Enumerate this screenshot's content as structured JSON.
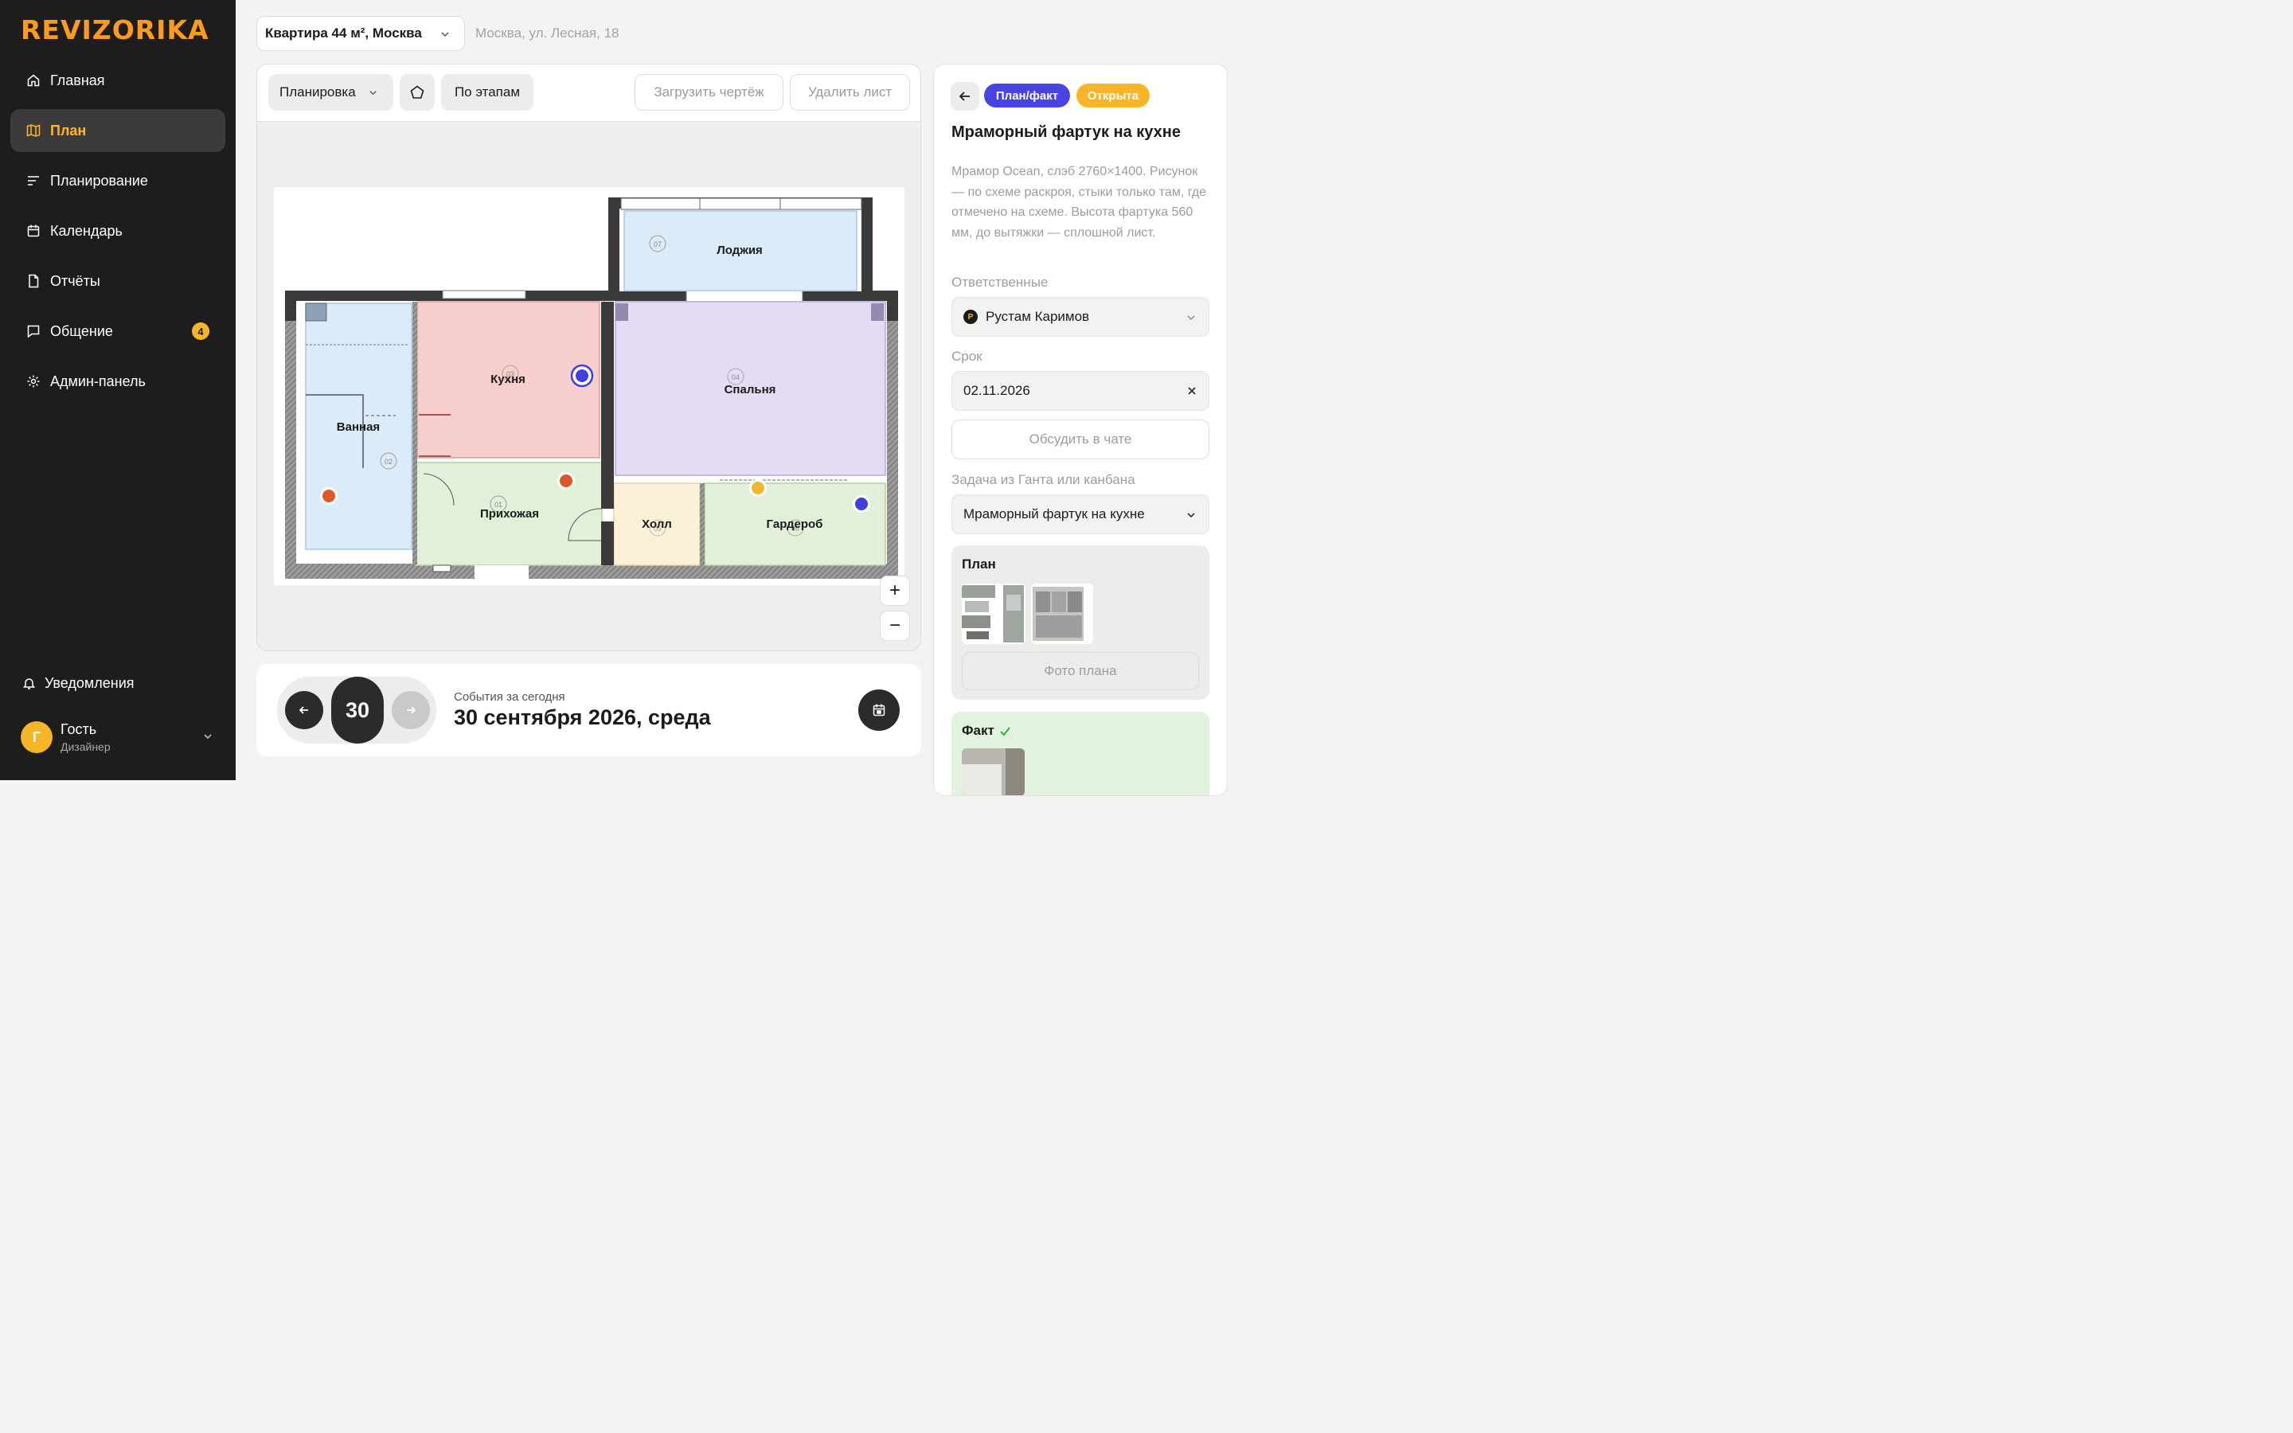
{
  "app": {
    "logo": "REVIZORIKA",
    "accent_color": "#ff9b1a"
  },
  "sidebar": {
    "items": [
      {
        "label": "Главная",
        "icon": "home-icon"
      },
      {
        "label": "План",
        "icon": "map-icon",
        "active": true
      },
      {
        "label": "Планирование",
        "icon": "list-icon"
      },
      {
        "label": "Календарь",
        "icon": "calendar-icon"
      },
      {
        "label": "Отчёты",
        "icon": "document-icon"
      },
      {
        "label": "Общение",
        "icon": "chat-icon",
        "badge": "4"
      },
      {
        "label": "Админ-панель",
        "icon": "gear-icon"
      }
    ],
    "notifications_label": "Уведомления",
    "user": {
      "initial": "Г",
      "name": "Гость",
      "role": "Дизайнер"
    }
  },
  "header": {
    "project": "Квартира 44 м², Москва",
    "address": "Москва, ул. Лесная, 18"
  },
  "plan": {
    "toolbar": {
      "layer_select": "Планировка",
      "stages_button": "По этапам",
      "upload_button": "Загрузить чертёж",
      "delete_button": "Удалить лист"
    },
    "rooms": [
      {
        "name": "Лоджия",
        "number": "07",
        "color": "#dcebf8"
      },
      {
        "name": "Кухня",
        "number": "03",
        "color": "#f6cfcd"
      },
      {
        "name": "Спальня",
        "number": "04",
        "color": "#e3dcf3"
      },
      {
        "name": "Ванная",
        "number": "02",
        "color": "#dcebf8"
      },
      {
        "name": "Прихожая",
        "number": "01",
        "color": "#e3f0d9"
      },
      {
        "name": "Холл",
        "number": "05",
        "color": "#fbf0d8"
      },
      {
        "name": "Гардероб",
        "number": "06",
        "color": "#e3f0d9"
      }
    ],
    "markers": [
      {
        "color": "#4040e0",
        "selected": true
      },
      {
        "color": "#e0552a"
      },
      {
        "color": "#e0552a"
      },
      {
        "color": "#f2b62d"
      },
      {
        "color": "#4040e0"
      }
    ],
    "zoom_in": "+",
    "zoom_out": "−"
  },
  "events": {
    "day": "30",
    "subtitle": "События за сегодня",
    "date": "30 сентября 2026, среда"
  },
  "task": {
    "tag_type": "План/факт",
    "tag_status": "Открыта",
    "title": "Мраморный фартук на кухне",
    "description": "Мрамор Ocean, слэб 2760×1400. Рисунок — по схеме раскроя, стыки только там, где отмечено на схеме. Высота фартука 560 мм, до вытяжки — сплошной лист.",
    "responsible_label": "Ответственные",
    "responsible_initial": "Р",
    "responsible": "Рустам Каримов",
    "deadline_label": "Срок",
    "deadline": "02.11.2026",
    "discuss_button": "Обсудить в чате",
    "gantt_label": "Задача из Ганта или канбана",
    "gantt_task": "Мраморный фартук на кухне",
    "plan_block_title": "План",
    "plan_photo_button": "Фото плана",
    "fact_block_title": "Факт"
  }
}
